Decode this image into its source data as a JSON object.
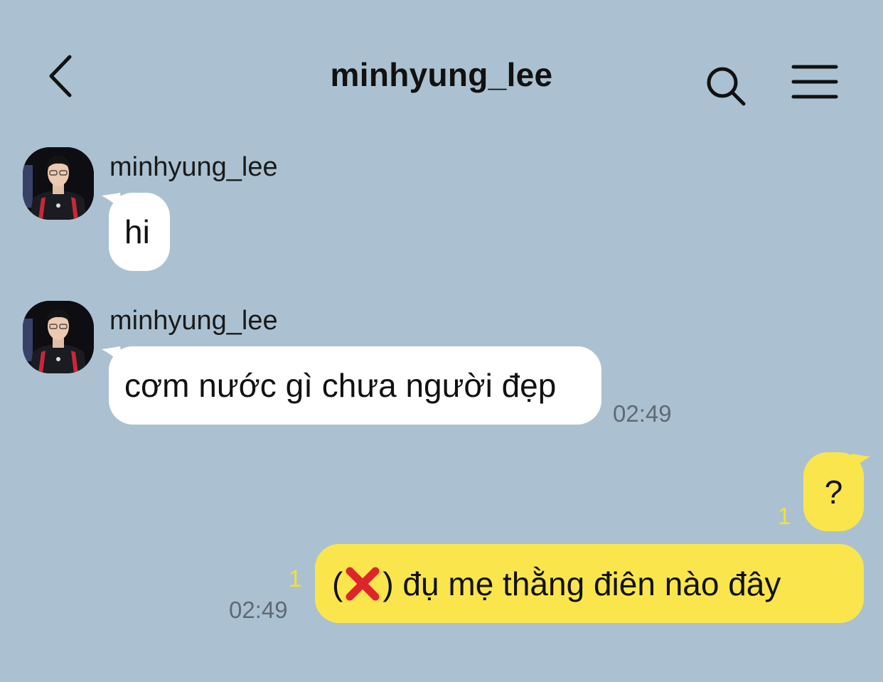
{
  "header": {
    "title": "minhyung_lee",
    "back_icon": "chevron-left-icon",
    "search_icon": "search-icon",
    "menu_icon": "hamburger-menu-icon"
  },
  "messages": [
    {
      "direction": "incoming",
      "sender": "minhyung_lee",
      "text": "hi",
      "time": ""
    },
    {
      "direction": "incoming",
      "sender": "minhyung_lee",
      "text": "cơm nước gì chưa người đẹp",
      "time": "02:49"
    },
    {
      "direction": "outgoing",
      "text": "?",
      "unread_count": "1",
      "time": ""
    },
    {
      "direction": "outgoing",
      "text_before": "(",
      "emoji": "cross-mark-emoji",
      "text_after": ") đụ mẹ thằng điên nào đây",
      "unread_count": "1",
      "time": "02:49"
    }
  ],
  "colors": {
    "background": "#abc1d1",
    "incoming_bubble": "#ffffff",
    "outgoing_bubble": "#fae64c",
    "unread": "#f3df3b",
    "timestamp": "#5f6a76"
  }
}
